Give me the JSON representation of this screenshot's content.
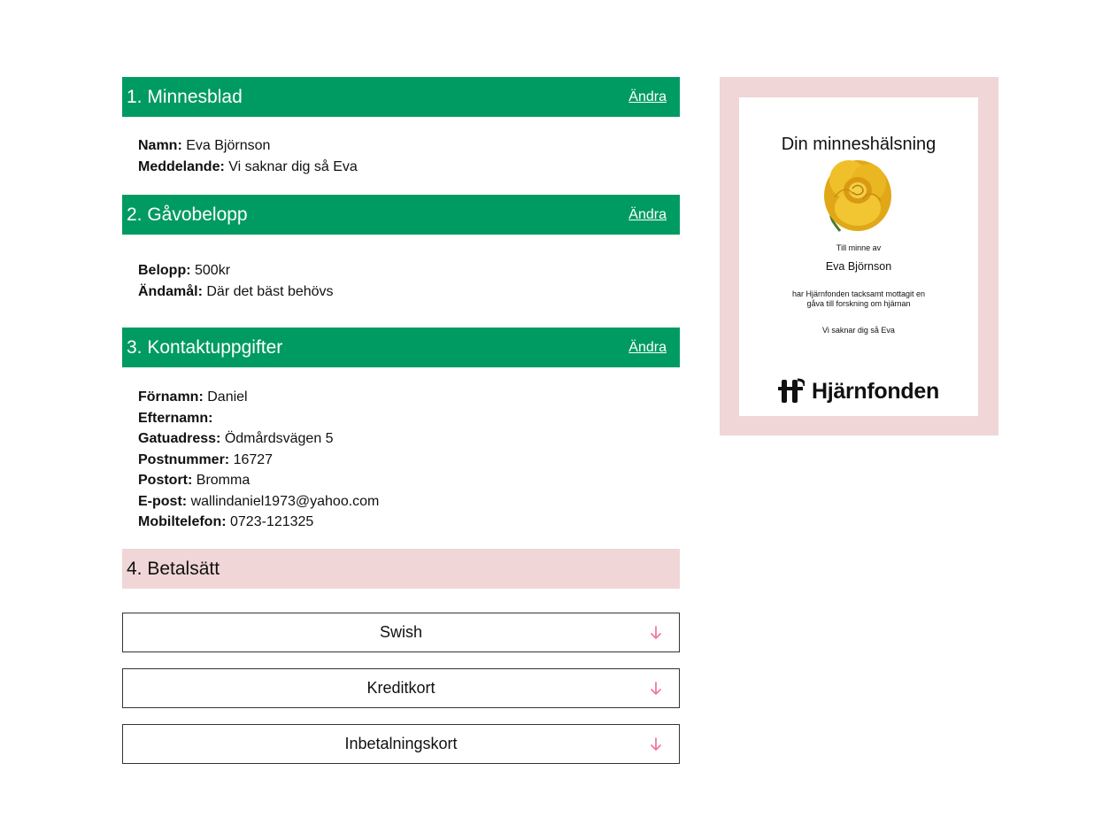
{
  "sections": {
    "s1": {
      "title": "1. Minnesblad",
      "edit": "Ändra",
      "rows": [
        {
          "label": "Namn:",
          "value": "Eva Björnson"
        },
        {
          "label": "Meddelande:",
          "value": "Vi saknar dig så Eva"
        }
      ]
    },
    "s2": {
      "title": "2. Gåvobelopp",
      "edit": "Ändra",
      "rows": [
        {
          "label": "Belopp:",
          "value": "500kr"
        },
        {
          "label": "Ändamål:",
          "value": "Där det bäst behövs"
        }
      ]
    },
    "s3": {
      "title": "3. Kontaktuppgifter",
      "edit": "Ändra",
      "rows": [
        {
          "label": "Förnamn:",
          "value": "Daniel"
        },
        {
          "label": "Efternamn:",
          "value": ""
        },
        {
          "label": "Gatuadress:",
          "value": "Ödmårdsvägen 5"
        },
        {
          "label": "Postnummer:",
          "value": "16727"
        },
        {
          "label": "Postort:",
          "value": "Bromma"
        },
        {
          "label": "E-post:",
          "value": "wallindaniel1973@yahoo.com"
        },
        {
          "label": "Mobiltelefon:",
          "value": " 0723-121325"
        }
      ]
    },
    "s4": {
      "title": "4. Betalsätt",
      "options": [
        "Swish",
        "Kreditkort",
        "Inbetalningskort"
      ]
    }
  },
  "preview": {
    "title": "Din minneshälsning",
    "in_memory": "Till minne av",
    "name": "Eva Björnson",
    "thanks_line1": "har Hjärnfonden tacksamt mottagit en",
    "thanks_line2": "gåva till forskning om hjärnan",
    "message": "Vi saknar dig så Eva",
    "logo_text": "Hjärnfonden",
    "icon": "rose-image"
  },
  "colors": {
    "section_header": "#009b62",
    "payment_header": "#f0d6d6",
    "arrow": "#f07aa0"
  }
}
